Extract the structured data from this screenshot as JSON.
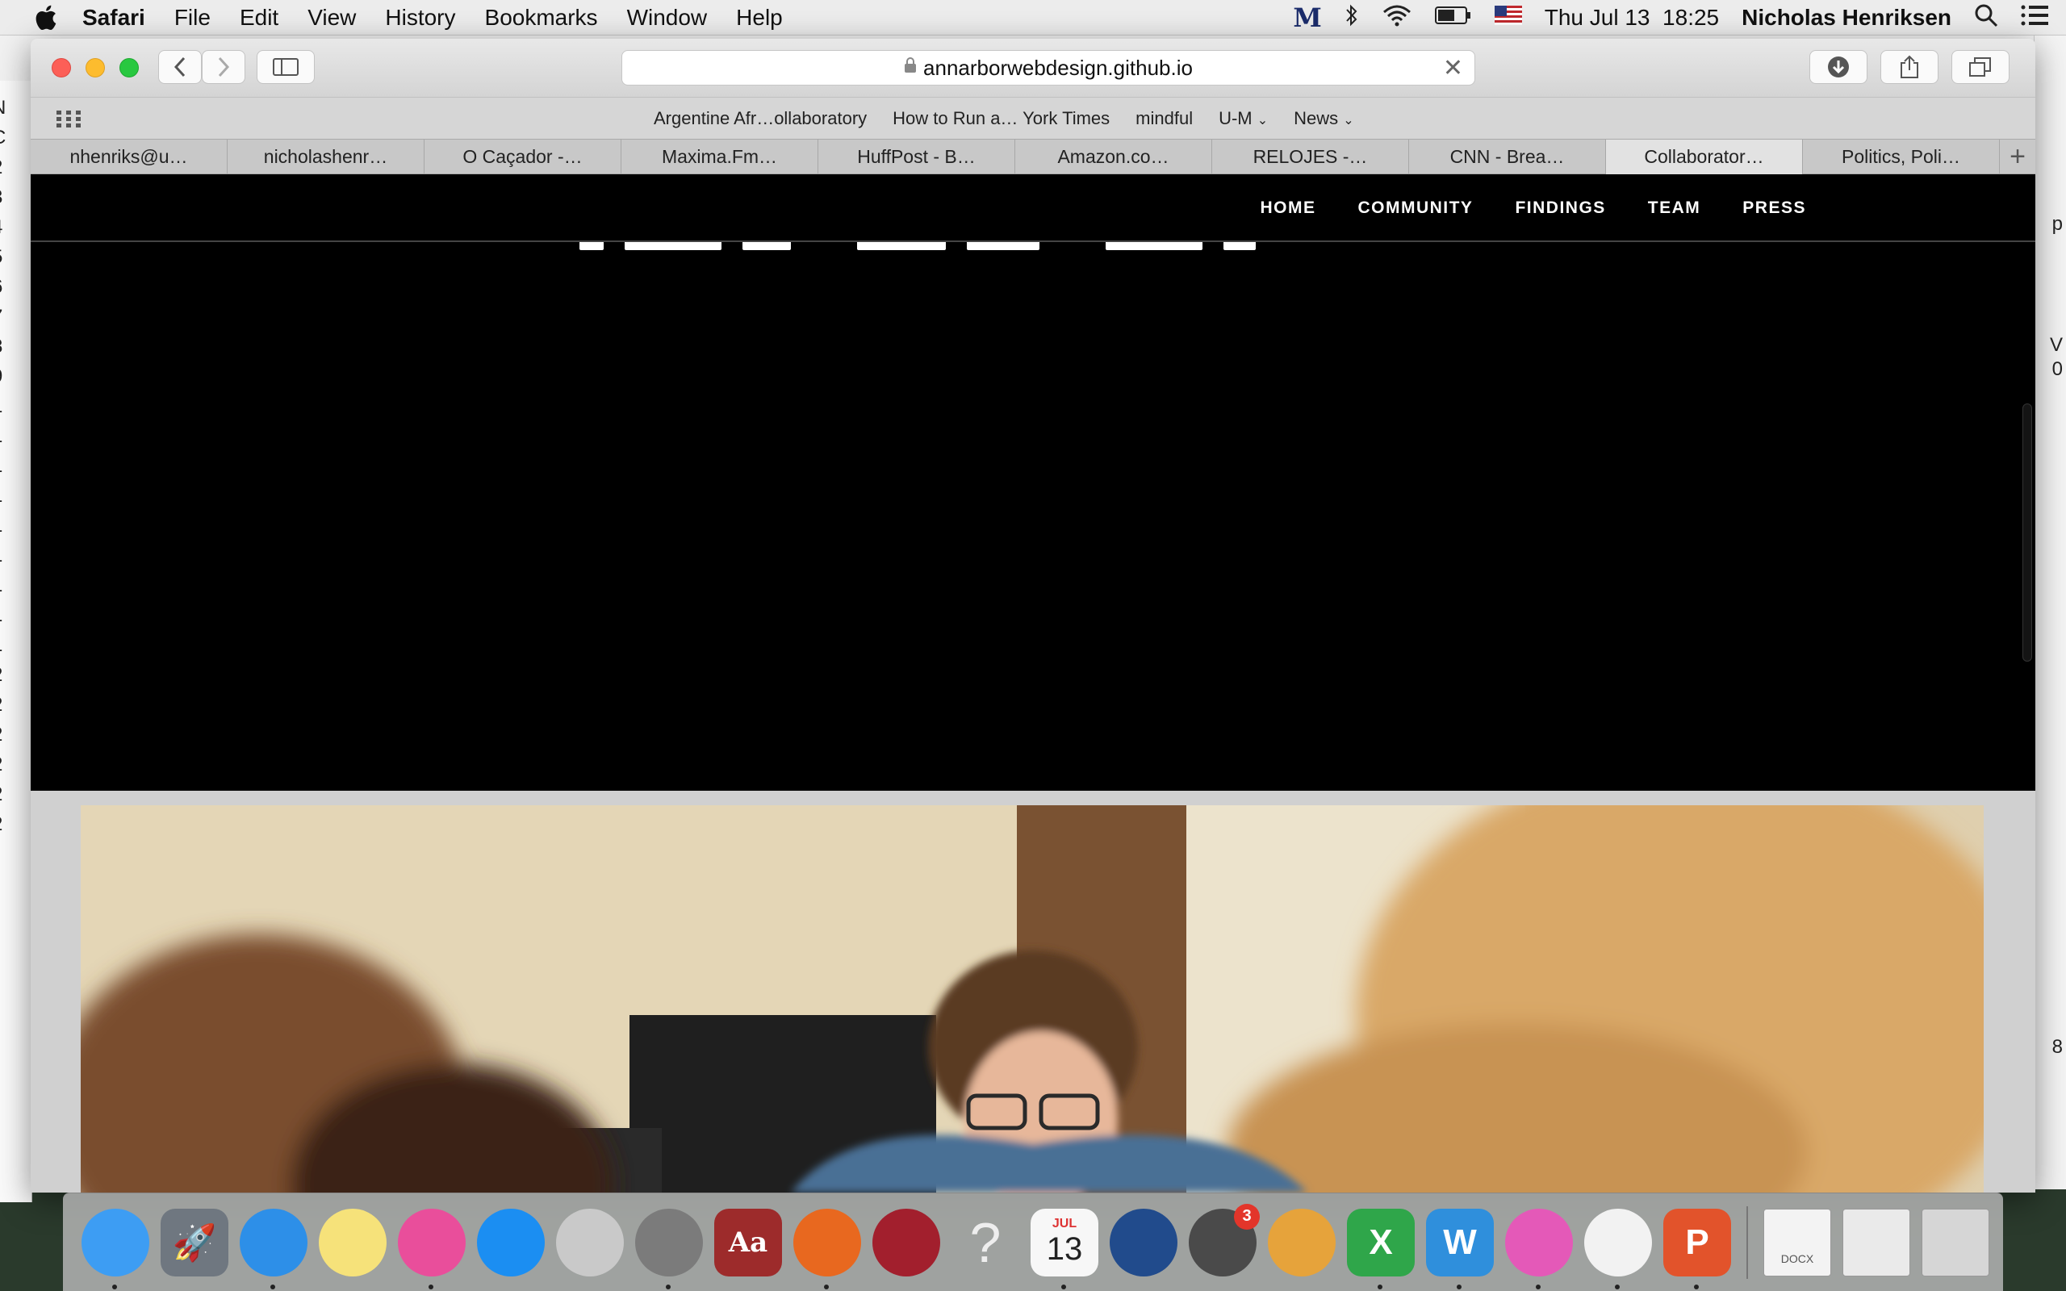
{
  "menubar": {
    "app_name": "Safari",
    "items": [
      "File",
      "Edit",
      "View",
      "History",
      "Bookmarks",
      "Window",
      "Help"
    ],
    "status": {
      "clock": "Thu Jul 13  18:25",
      "user": "Nicholas Henriksen"
    }
  },
  "browser": {
    "url": "annarborwebdesign.github.io",
    "favorites": [
      "Argentine Afr…ollaboratory",
      "How to Run a… York Times",
      "mindful",
      "U-M",
      "News"
    ],
    "tabs": [
      {
        "label": "nhenriks@u…"
      },
      {
        "label": "nicholashenr…"
      },
      {
        "label": "O Caçador -…"
      },
      {
        "label": "Maxima.Fm…"
      },
      {
        "label": "HuffPost - B…"
      },
      {
        "label": "Amazon.co…"
      },
      {
        "label": "RELOJES -…"
      },
      {
        "label": "CNN - Brea…"
      },
      {
        "label": "Collaborator…"
      },
      {
        "label": "Politics, Poli…"
      }
    ],
    "active_tab_index": 8
  },
  "page": {
    "nav": [
      "HOME",
      "COMMUNITY",
      "FINDINGS",
      "TEAM",
      "PRESS"
    ]
  },
  "background_windows": {
    "left_edge": [
      "N",
      "C",
      "2",
      "3",
      "4",
      "5",
      "6",
      "7",
      "8",
      "9",
      "1",
      "1",
      "1",
      "1",
      "1",
      "1",
      "1",
      "1",
      "1",
      "2",
      "2",
      "2",
      "2",
      "2",
      "2"
    ],
    "right_edge": [
      "p",
      "V",
      "0",
      "8"
    ]
  },
  "dock": {
    "calendar": {
      "month": "JUL",
      "day": "13"
    },
    "mail_badge": "3",
    "items": [
      {
        "name": "finder-icon",
        "color": "#3d9df3"
      },
      {
        "name": "launchpad-icon",
        "color": "#6f7780"
      },
      {
        "name": "safari-icon",
        "color": "#2d8fe8"
      },
      {
        "name": "notes-icon",
        "color": "#f6e27a"
      },
      {
        "name": "itunes-icon",
        "color": "#e94e9b"
      },
      {
        "name": "app-store-icon",
        "color": "#1b8ef2"
      },
      {
        "name": "calculator-icon",
        "color": "#c9c9c9"
      },
      {
        "name": "system-preferences-icon",
        "color": "#7b7b7b"
      },
      {
        "name": "dictionary-icon",
        "color": "#9d2b2b"
      },
      {
        "name": "firefox-icon",
        "color": "#e8681f"
      },
      {
        "name": "photo-booth-icon",
        "color": "#a21f2d"
      },
      {
        "name": "help-icon",
        "color": "#bdbdbd"
      },
      {
        "name": "calendar-icon",
        "color": "#f7f7f7"
      },
      {
        "name": "globe-app-icon",
        "color": "#214b8c"
      },
      {
        "name": "mail-app-icon",
        "color": "#4a4a4a"
      },
      {
        "name": "jar-app-icon",
        "color": "#e6a33b"
      },
      {
        "name": "excel-icon",
        "color": "#2fa64a"
      },
      {
        "name": "word-icon",
        "color": "#2f8fdc"
      },
      {
        "name": "lips-app-icon",
        "color": "#e459b8"
      },
      {
        "name": "acrobat-icon",
        "color": "#f2f2f2"
      },
      {
        "name": "powerpoint-icon",
        "color": "#e2532b"
      }
    ],
    "right_items": [
      {
        "name": "docx-document-icon",
        "color": "#f3f3f3",
        "label": "DOCX"
      },
      {
        "name": "screenshot-folder-icon",
        "color": "#eaeaea"
      },
      {
        "name": "trash-icon",
        "color": "#d6d6d6"
      }
    ]
  }
}
